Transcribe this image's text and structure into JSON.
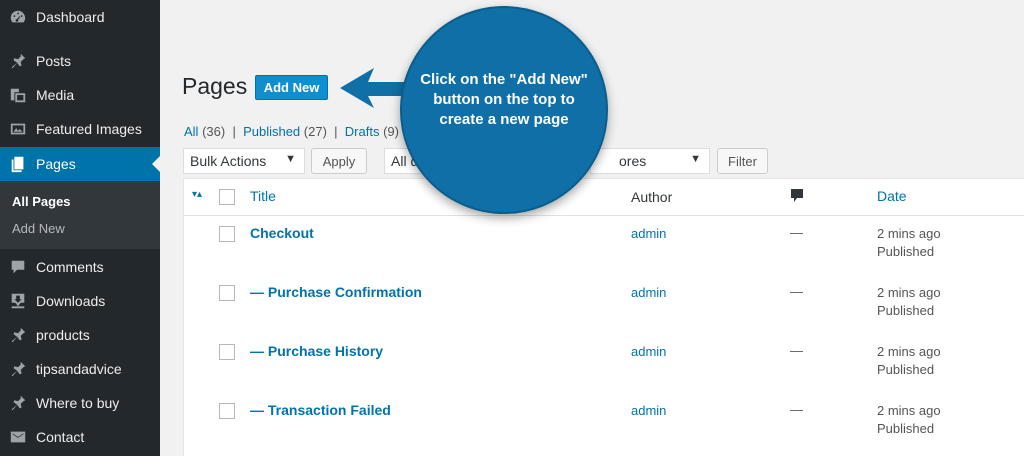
{
  "sidebar": {
    "items": [
      {
        "label": "Dashboard",
        "icon": "dashboard-icon"
      },
      {
        "label": "Posts",
        "icon": "pin-icon"
      },
      {
        "label": "Media",
        "icon": "media-icon"
      },
      {
        "label": "Featured Images",
        "icon": "image-icon"
      },
      {
        "label": "Pages",
        "icon": "pages-icon",
        "current": true
      },
      {
        "label": "Comments",
        "icon": "comment-icon"
      },
      {
        "label": "Downloads",
        "icon": "download-icon"
      },
      {
        "label": "products",
        "icon": "pin-icon"
      },
      {
        "label": "tipsandadvice",
        "icon": "pin-icon"
      },
      {
        "label": "Where to buy",
        "icon": "pin-icon"
      },
      {
        "label": "Contact",
        "icon": "envelope-icon"
      }
    ],
    "submenu": [
      {
        "label": "All Pages",
        "current": true
      },
      {
        "label": "Add New"
      }
    ]
  },
  "header": {
    "title": "Pages",
    "add_new_label": "Add New"
  },
  "filters": {
    "all": {
      "label": "All",
      "count": "(36)"
    },
    "published": {
      "label": "Published",
      "count": "(27)"
    },
    "drafts": {
      "label": "Drafts",
      "count": "(9)"
    }
  },
  "toolbar": {
    "bulk_actions": "Bulk Actions",
    "apply": "Apply",
    "dates_partial": "All d",
    "categories_partial": "ores",
    "filter": "Filter"
  },
  "table": {
    "columns": {
      "title": "Title",
      "author": "Author",
      "date": "Date"
    },
    "rows": [
      {
        "title": "Checkout",
        "author": "admin",
        "comments": "—",
        "date": "2 mins ago",
        "status": "Published"
      },
      {
        "title": "— Purchase Confirmation",
        "author": "admin",
        "comments": "—",
        "date": "2 mins ago",
        "status": "Published"
      },
      {
        "title": "— Purchase History",
        "author": "admin",
        "comments": "—",
        "date": "2 mins ago",
        "status": "Published"
      },
      {
        "title": "— Transaction Failed",
        "author": "admin",
        "comments": "—",
        "date": "2 mins ago",
        "status": "Published"
      }
    ]
  },
  "callout": {
    "text": "Click on the \"Add New\" button on the top to create a new page"
  },
  "colors": {
    "sidebar_bg": "#23282d",
    "accent": "#0073aa",
    "callout": "#0f6fa6"
  }
}
